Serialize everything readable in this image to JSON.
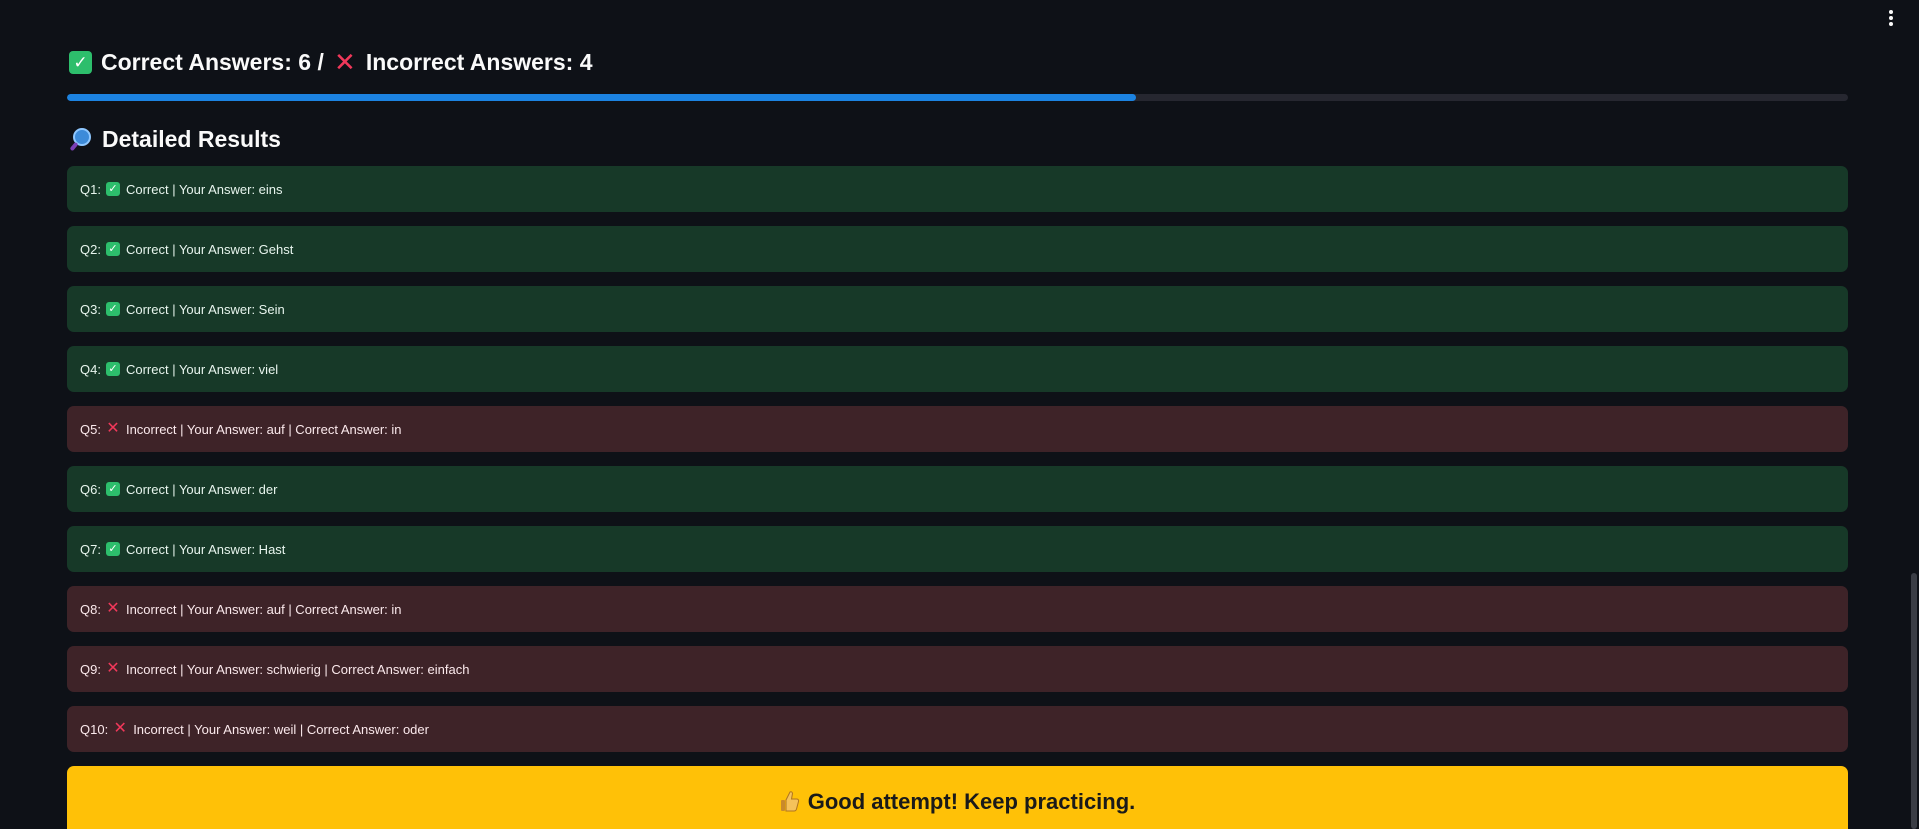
{
  "summary": {
    "correct_label": "Correct Answers: 6 /",
    "incorrect_label": "Incorrect Answers: 4",
    "correct_icon": "check-mark-button-icon",
    "incorrect_icon": "cross-mark-icon"
  },
  "progress": {
    "value": 0.6,
    "color": "#1c83e1"
  },
  "detailed": {
    "heading": "Detailed Results",
    "heading_icon": "magnifying-glass-icon"
  },
  "results": [
    {
      "q": "Q1:",
      "status": "correct",
      "text": "Correct | Your Answer: eins"
    },
    {
      "q": "Q2:",
      "status": "correct",
      "text": "Correct | Your Answer: Gehst"
    },
    {
      "q": "Q3:",
      "status": "correct",
      "text": "Correct | Your Answer: Sein"
    },
    {
      "q": "Q4:",
      "status": "correct",
      "text": "Correct | Your Answer: viel"
    },
    {
      "q": "Q5:",
      "status": "incorrect",
      "text": "Incorrect | Your Answer: auf | Correct Answer: in"
    },
    {
      "q": "Q6:",
      "status": "correct",
      "text": "Correct | Your Answer: der"
    },
    {
      "q": "Q7:",
      "status": "correct",
      "text": "Correct | Your Answer: Hast"
    },
    {
      "q": "Q8:",
      "status": "incorrect",
      "text": "Incorrect | Your Answer: auf | Correct Answer: in"
    },
    {
      "q": "Q9:",
      "status": "incorrect",
      "text": "Incorrect | Your Answer: schwierig | Correct Answer: einfach"
    },
    {
      "q": "Q10:",
      "status": "incorrect",
      "text": "Incorrect | Your Answer: weil | Correct Answer: oder"
    }
  ],
  "banner": {
    "text": "Good attempt! Keep practicing.",
    "icon": "thumbs-up-icon",
    "color": "#ffc107"
  },
  "colors": {
    "background": "#0e1117",
    "correct_row": "#173928",
    "incorrect_row": "#3e2328",
    "check": "#2dbe6c",
    "cross": "#f0385a"
  }
}
